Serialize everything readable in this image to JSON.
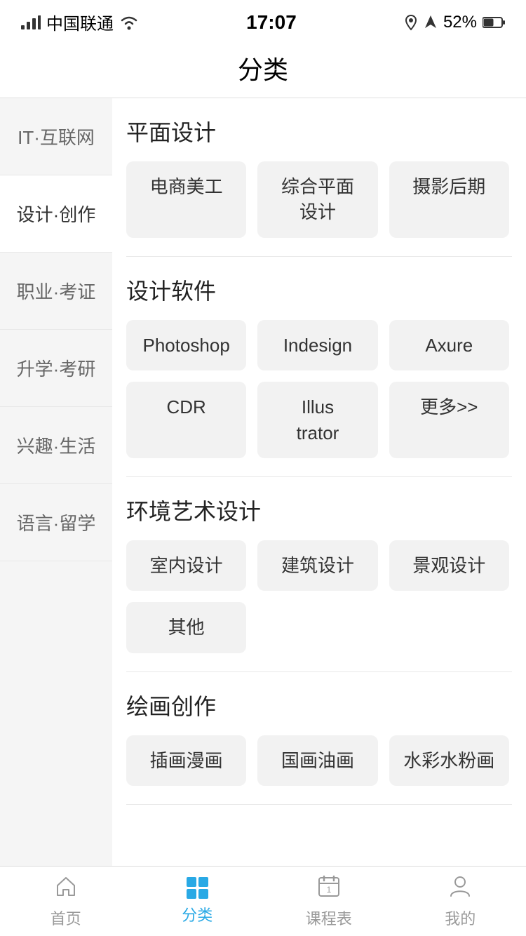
{
  "statusBar": {
    "carrier": "中国联通",
    "time": "17:07",
    "battery": "52%"
  },
  "pageTitle": "分类",
  "sidebar": {
    "items": [
      {
        "id": "it",
        "label": "IT·互联网",
        "active": false
      },
      {
        "id": "design-create",
        "label": "设计·创作",
        "active": true
      },
      {
        "id": "career",
        "label": "职业·考证",
        "active": false
      },
      {
        "id": "university",
        "label": "升学·考研",
        "active": false
      },
      {
        "id": "hobby",
        "label": "兴趣·生活",
        "active": false
      },
      {
        "id": "language",
        "label": "语言·留学",
        "active": false
      }
    ]
  },
  "categories": [
    {
      "id": "graphic-design",
      "title": "平面设计",
      "tags": [
        {
          "id": "ecom-beauty",
          "label": "电商美工"
        },
        {
          "id": "comprehensive-graphic",
          "label": "综合平面\n设计"
        },
        {
          "id": "photo-post",
          "label": "摄影后期"
        }
      ]
    },
    {
      "id": "design-software",
      "title": "设计软件",
      "tags": [
        {
          "id": "photoshop",
          "label": "Photoshop"
        },
        {
          "id": "indesign",
          "label": "Indesign"
        },
        {
          "id": "axure",
          "label": "Axure"
        },
        {
          "id": "cdr",
          "label": "CDR"
        },
        {
          "id": "illustrator",
          "label": "Illus\ntrator"
        },
        {
          "id": "more",
          "label": "更多>>"
        }
      ]
    },
    {
      "id": "env-art",
      "title": "环境艺术设计",
      "tags": [
        {
          "id": "interior",
          "label": "室内设计"
        },
        {
          "id": "architecture",
          "label": "建筑设计"
        },
        {
          "id": "landscape",
          "label": "景观设计"
        },
        {
          "id": "other",
          "label": "其他"
        }
      ]
    },
    {
      "id": "painting",
      "title": "绘画创作",
      "tags": [
        {
          "id": "illustration-comic",
          "label": "插画漫画"
        },
        {
          "id": "chinese-oil",
          "label": "国画油画"
        },
        {
          "id": "watercolor",
          "label": "水彩水粉画"
        }
      ]
    }
  ],
  "bottomNav": {
    "items": [
      {
        "id": "home",
        "label": "首页",
        "icon": "home",
        "active": false
      },
      {
        "id": "category",
        "label": "分类",
        "icon": "grid",
        "active": true
      },
      {
        "id": "schedule",
        "label": "课程表",
        "icon": "calendar",
        "active": false
      },
      {
        "id": "profile",
        "label": "我的",
        "icon": "person",
        "active": false
      }
    ]
  }
}
